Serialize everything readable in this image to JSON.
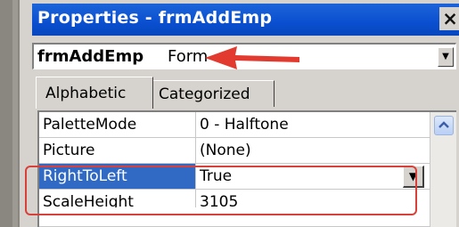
{
  "window": {
    "title": "Properties - frmAddEmp",
    "close_label": "×"
  },
  "object_combo": {
    "name": "frmAddEmp",
    "type": "Form",
    "button_icon": "dropdown-arrow"
  },
  "tabs": [
    {
      "label": "Alphabetic",
      "active": true
    },
    {
      "label": "Categorized",
      "active": false
    }
  ],
  "properties": [
    {
      "name": "PaletteMode",
      "value": "0 - Halftone"
    },
    {
      "name": "Picture",
      "value": "(None)"
    },
    {
      "name": "RightToLeft",
      "value": "True",
      "selected": true
    },
    {
      "name": "ScaleHeight",
      "value": "3105"
    }
  ],
  "colors": {
    "title_bar": "#0a4fd0",
    "selection": "#316ac5",
    "annotation_red": "#d8403a"
  }
}
